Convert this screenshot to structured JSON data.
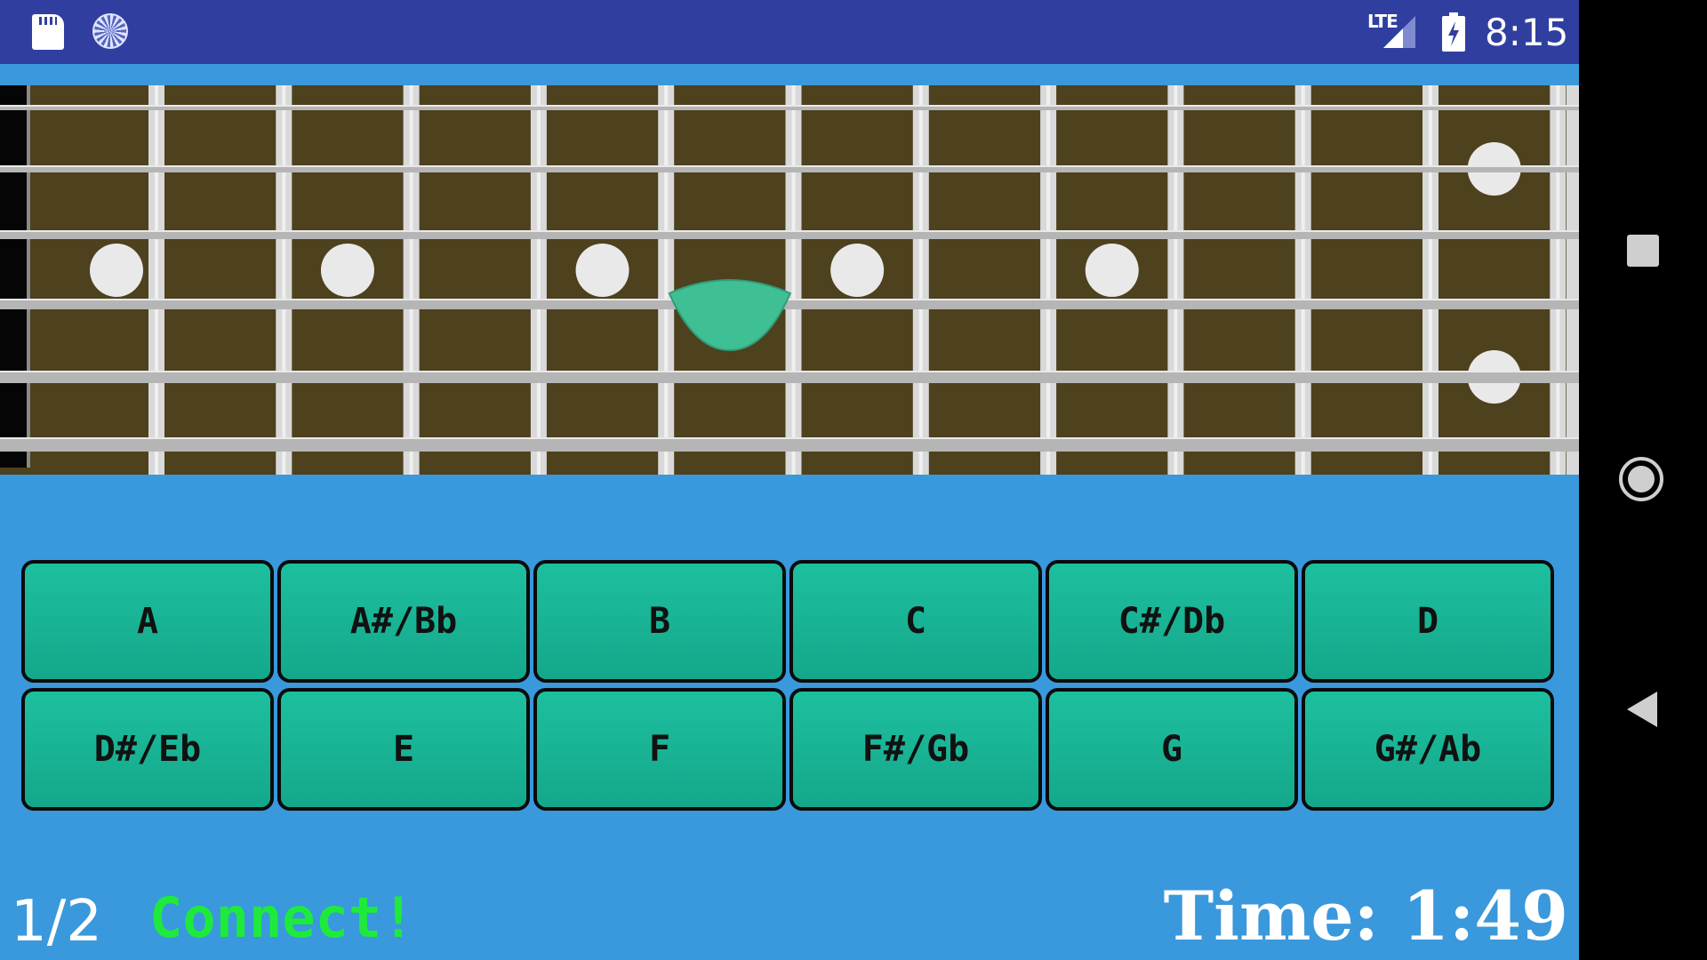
{
  "status_bar": {
    "time": "8:15",
    "network": "LTE",
    "icons": [
      "sd-card-icon",
      "sync-icon",
      "signal-icon",
      "battery-charging-icon"
    ]
  },
  "fretboard": {
    "strings": 6,
    "frets": 12,
    "highlighted_note": {
      "string": 3,
      "fret": 6
    },
    "colors": {
      "wood": "#4d411e",
      "fret": "#d9d9d9",
      "string": "#b5b5b5",
      "marker": "#e9e9e9",
      "highlight": "#3fbf94"
    }
  },
  "notes": {
    "row1": [
      "A",
      "A#/Bb",
      "B",
      "C",
      "C#/Db",
      "D"
    ],
    "row2": [
      "D#/Eb",
      "E",
      "F",
      "F#/Gb",
      "G",
      "G#/Ab"
    ]
  },
  "footer": {
    "progress": "1/2",
    "feedback": "Connect!",
    "timer": "Time: 1:49"
  },
  "colors": {
    "app_background": "#3a98dc",
    "status_bar": "#303f9f",
    "button": "#1dbf9f",
    "feedback": "#1eea3c"
  }
}
